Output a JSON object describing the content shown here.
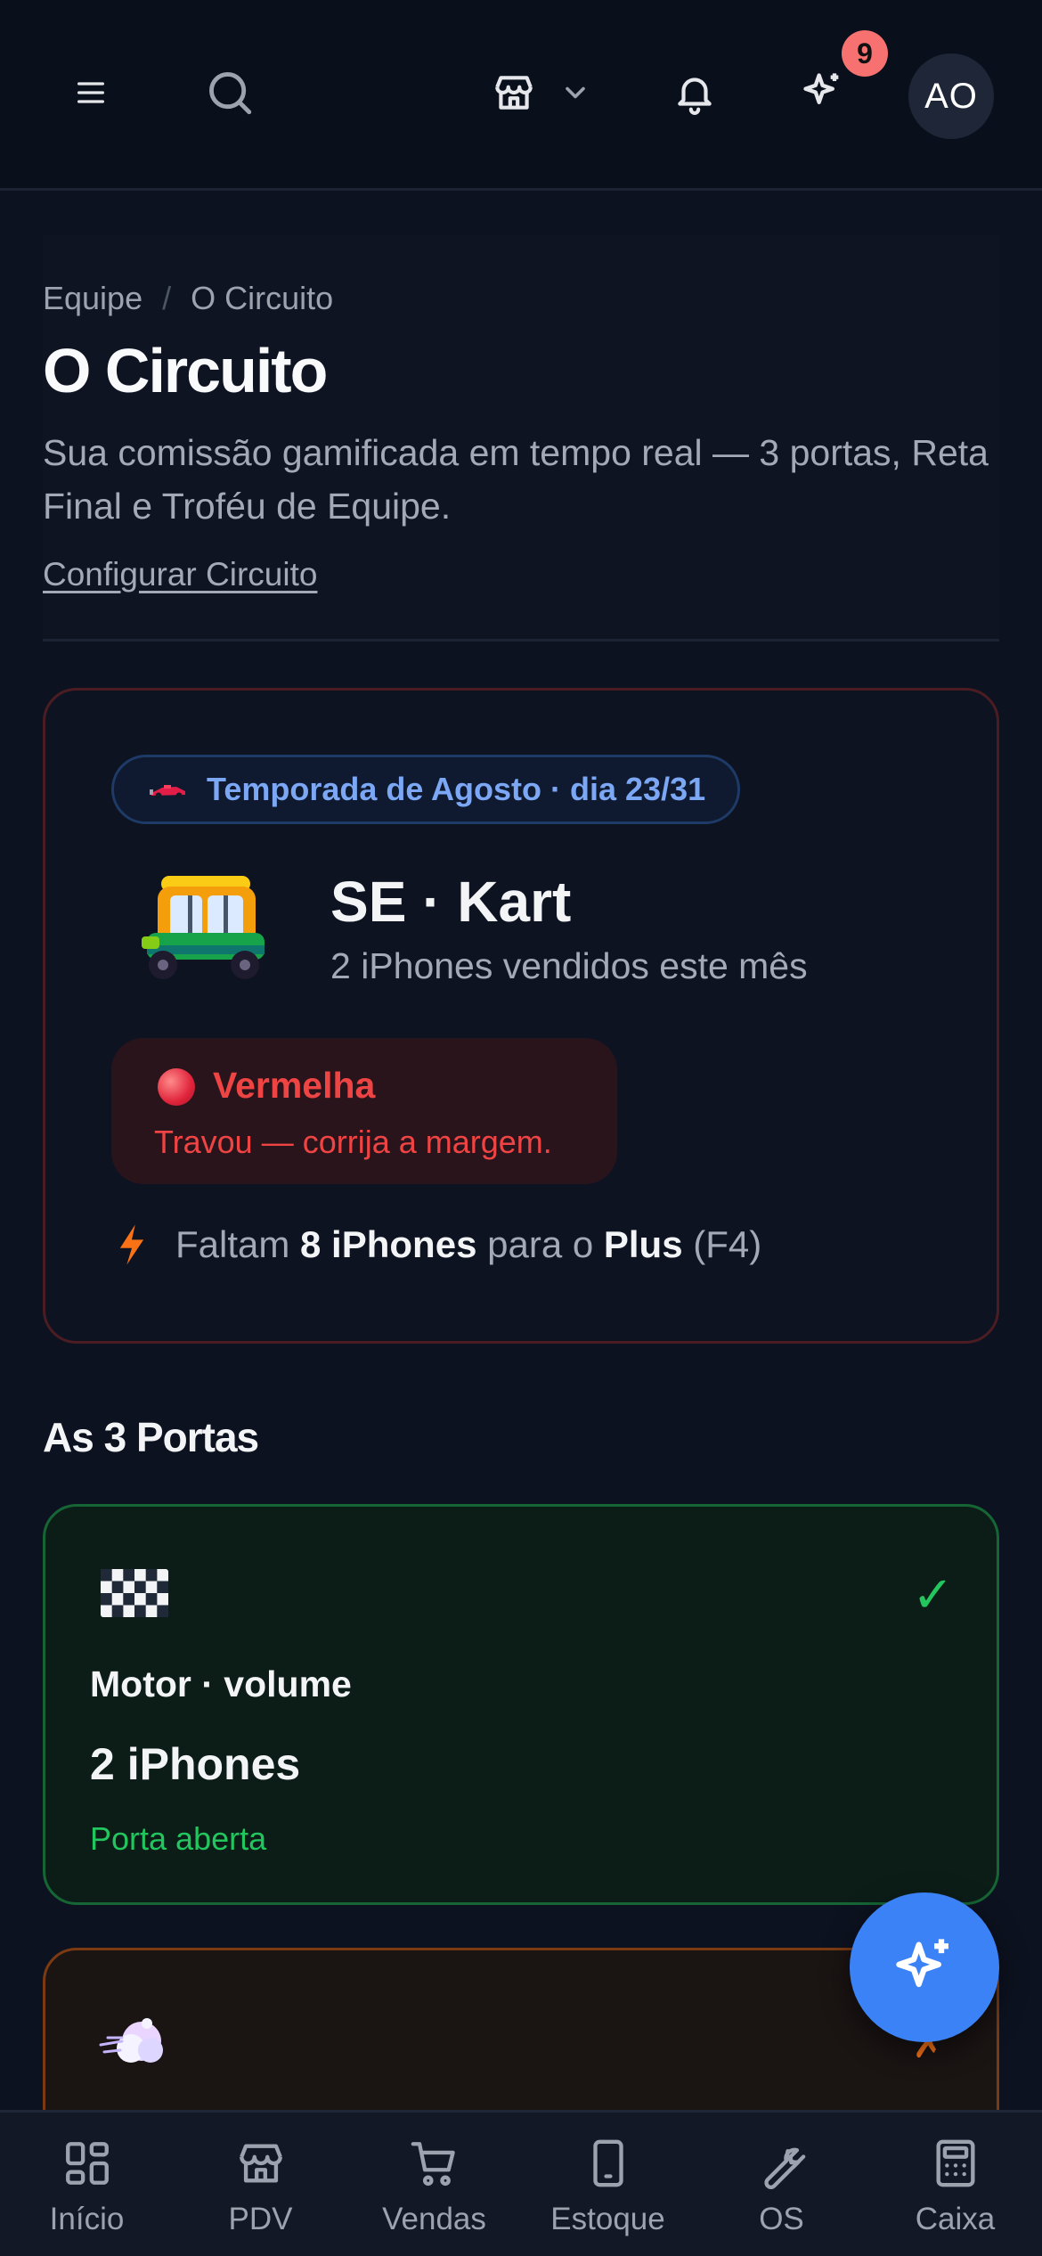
{
  "topbar": {
    "notification_count": "9",
    "avatar_initials": "AO",
    "icons": [
      "menu-icon",
      "search-icon",
      "store-icon",
      "chevron-down-icon",
      "bell-icon",
      "sparkles-icon"
    ]
  },
  "header": {
    "breadcrumb": [
      "Equipe",
      "O Circuito"
    ],
    "breadcrumb_separator": "/",
    "title": "O Circuito",
    "subtitle": "Sua comissão gamificada em tempo real — 3 portas, Reta Final e Troféu de Equipe.",
    "config_link": "Configurar Circuito"
  },
  "season": {
    "pill": "Temporada de Agosto · dia 23/31",
    "tier_name": "SE · Kart",
    "tier_sub": "2 iPhones vendidos este mês",
    "status_title": "Vermelha",
    "status_message": "Travou — corrija a margem.",
    "goal": {
      "prefix": "Faltam",
      "amount": "8 iPhones",
      "middle": "para o",
      "target": "Plus",
      "code": "(F4)"
    }
  },
  "gates": {
    "section_title": "As 3 Portas",
    "items": [
      {
        "name": "Motor · volume",
        "value": "2 iPhones",
        "status": "Porta aberta",
        "state_mark": "✓",
        "status_color": "#22c55e"
      },
      {
        "state_mark": "✗",
        "status_color": "#f97316"
      }
    ]
  },
  "nav": {
    "items": [
      {
        "label": "Início",
        "icon": "grid-icon"
      },
      {
        "label": "PDV",
        "icon": "store-icon"
      },
      {
        "label": "Vendas",
        "icon": "cart-icon"
      },
      {
        "label": "Estoque",
        "icon": "phone-icon"
      },
      {
        "label": "OS",
        "icon": "wrench-icon"
      },
      {
        "label": "Caixa",
        "icon": "calculator-icon"
      }
    ]
  },
  "colors": {
    "background": "#0d1220",
    "accent": "#3b82f6",
    "danger": "#ef4444",
    "success": "#22c55e",
    "warning": "#f97316",
    "pill_text": "#7ba7f5"
  }
}
